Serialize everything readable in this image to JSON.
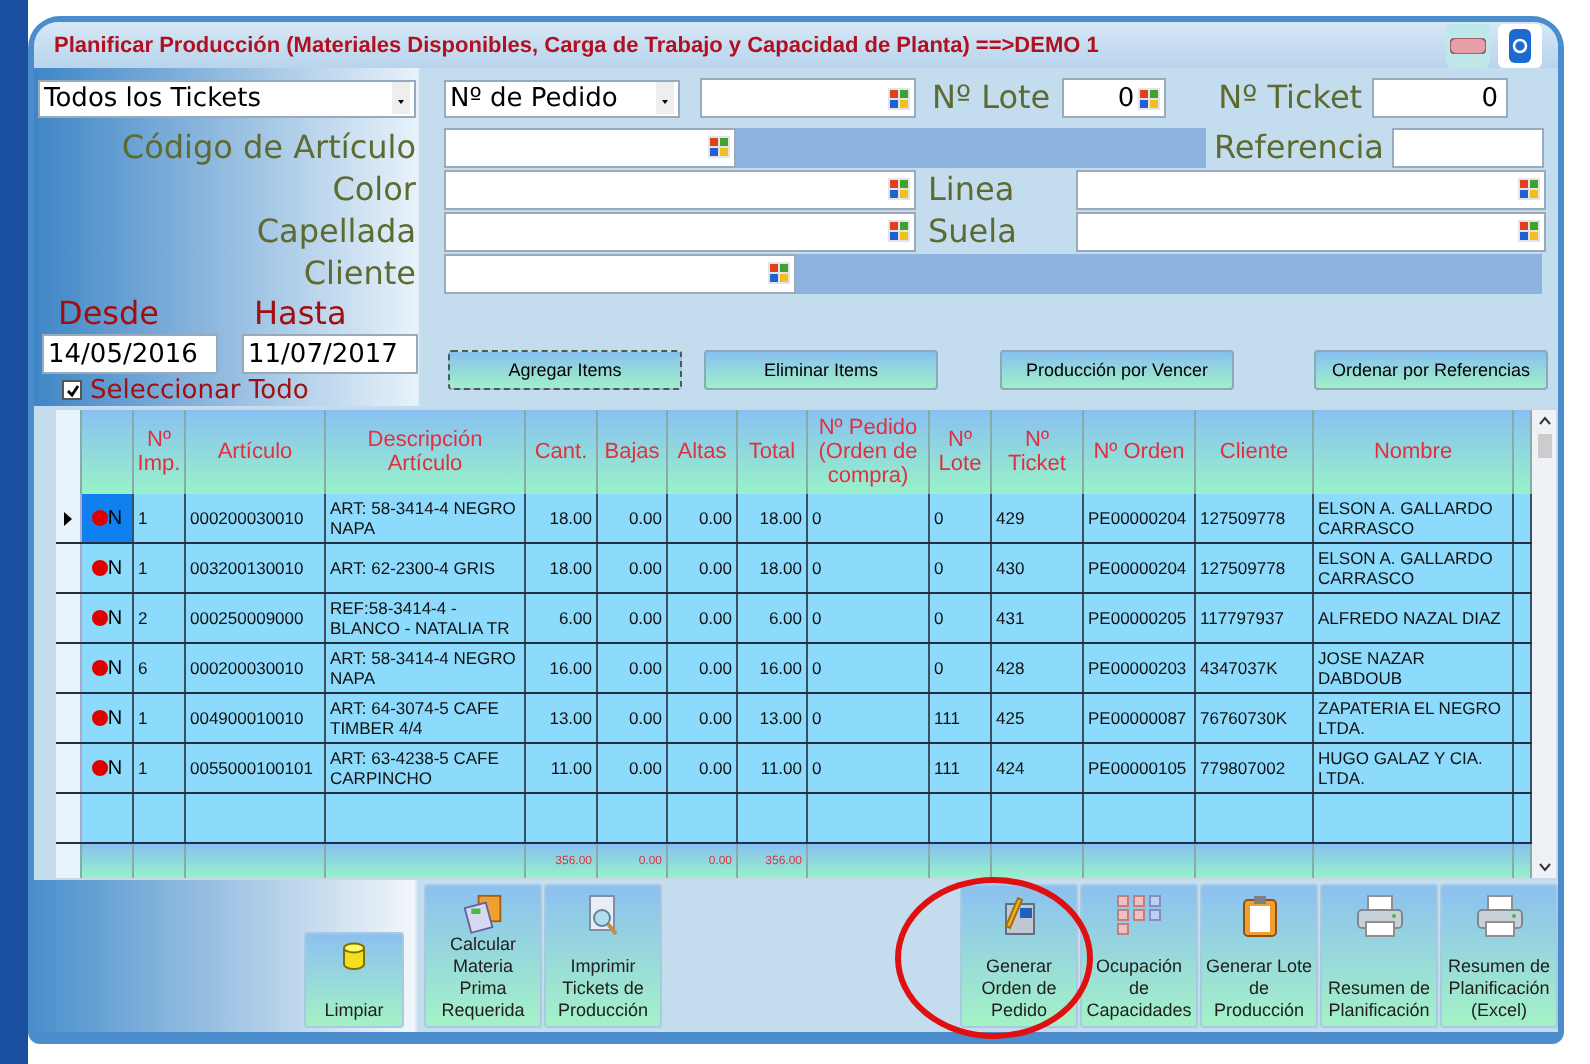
{
  "window": {
    "title": "Planificar Producción (Materiales Disponibles, Carga de Trabajo y Capacidad de Planta) ==>DEMO 1"
  },
  "filters": {
    "ticket_type": "Todos los Tickets",
    "search_by": "Nº de Pedido",
    "lote_label": "Nº Lote",
    "lote_value": "0",
    "ticket_label": "Nº Ticket",
    "ticket_value": "0",
    "codigo_label": "Código de Artículo",
    "referencia_label": "Referencia",
    "color_label": "Color",
    "linea_label": "Linea",
    "capellada_label": "Capellada",
    "suela_label": "Suela",
    "cliente_label": "Cliente",
    "desde_label": "Desde",
    "hasta_label": "Hasta",
    "desde_value": "14/05/2016",
    "hasta_value": "11/07/2017"
  },
  "select_all": {
    "label": "Seleccionar Todo",
    "checked": true
  },
  "actions": [
    "Agregar Items",
    "Eliminar Items",
    "Producción por Vencer",
    "Ordenar por Referencias"
  ],
  "table": {
    "columns": [
      {
        "label": "Nº Imp.",
        "kind": "text"
      },
      {
        "label": "Artículo",
        "kind": "text"
      },
      {
        "label": "Descripción Artículo",
        "kind": "text"
      },
      {
        "label": "Cant.",
        "kind": "number",
        "total": "356.00"
      },
      {
        "label": "Bajas",
        "kind": "number",
        "total": "0.00"
      },
      {
        "label": "Altas",
        "kind": "number",
        "total": "0.00"
      },
      {
        "label": "Total",
        "kind": "number",
        "total": "356.00"
      },
      {
        "label": "Nº Pedido (Orden de compra)",
        "kind": "text"
      },
      {
        "label": "Nº Lote",
        "kind": "text"
      },
      {
        "label": "Nº Ticket",
        "kind": "text"
      },
      {
        "label": "Nº Orden",
        "kind": "text"
      },
      {
        "label": "Cliente",
        "kind": "text"
      },
      {
        "label": "Nombre",
        "kind": "text"
      }
    ],
    "rows": [
      {
        "selected": true,
        "status": "N",
        "cells": [
          "1",
          "000200030010",
          "ART: 58-3414-4 NEGRO NAPA",
          "18.00",
          "0.00",
          "0.00",
          "18.00",
          "0",
          "0",
          "429",
          "PE00000204",
          "127509778",
          "ELSON A. GALLARDO CARRASCO"
        ]
      },
      {
        "selected": false,
        "status": "N",
        "cells": [
          "1",
          "003200130010",
          "ART: 62-2300-4 GRIS",
          "18.00",
          "0.00",
          "0.00",
          "18.00",
          "0",
          "0",
          "430",
          "PE00000204",
          "127509778",
          "ELSON A. GALLARDO CARRASCO"
        ]
      },
      {
        "selected": false,
        "status": "N",
        "cells": [
          "2",
          "000250009000",
          "REF:58-3414-4 - BLANCO - NATALIA TR",
          "6.00",
          "0.00",
          "0.00",
          "6.00",
          "0",
          "0",
          "431",
          "PE00000205",
          "117797937",
          "ALFREDO NAZAL DIAZ"
        ]
      },
      {
        "selected": false,
        "status": "N",
        "cells": [
          "6",
          "000200030010",
          "ART: 58-3414-4 NEGRO NAPA",
          "16.00",
          "0.00",
          "0.00",
          "16.00",
          "0",
          "0",
          "428",
          "PE00000203",
          "4347037K",
          "JOSE NAZAR DABDOUB"
        ]
      },
      {
        "selected": false,
        "status": "N",
        "cells": [
          "1",
          "004900010010",
          "ART: 64-3074-5 CAFE TIMBER 4/4",
          "13.00",
          "0.00",
          "0.00",
          "13.00",
          "0",
          "111",
          "425",
          "PE00000087",
          "76760730K",
          "ZAPATERIA EL NEGRO LTDA."
        ]
      },
      {
        "selected": false,
        "status": "N",
        "cells": [
          "1",
          "0055000100101",
          "ART: 63-4238-5 CAFE CARPINCHO",
          "11.00",
          "0.00",
          "0.00",
          "11.00",
          "0",
          "111",
          "424",
          "PE00000105",
          "779807002",
          "HUGO GALAZ Y CIA. LTDA."
        ]
      }
    ]
  },
  "tools": [
    {
      "label": "Limpiar",
      "kind": "cylinder"
    },
    {
      "label": "Calcular Materia Prima Requerida",
      "kind": "stack"
    },
    {
      "label": "Imprimir Tickets de Producción",
      "kind": "magnifier"
    },
    {
      "label": "Generar Orden de Pedido",
      "kind": "pencil"
    },
    {
      "label": "Ocupación de Capacidades",
      "kind": "grid"
    },
    {
      "label": "Generar Lote de Producción",
      "kind": "clipboard"
    },
    {
      "label": "Resumen de Planificación",
      "kind": "printer"
    },
    {
      "label": "Resumen de Planificación (Excel)",
      "kind": "printer"
    }
  ]
}
